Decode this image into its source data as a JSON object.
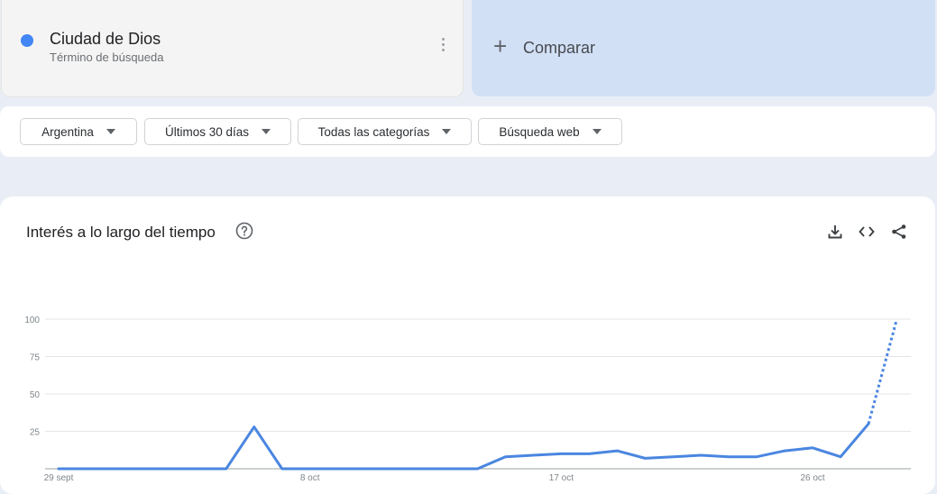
{
  "term": {
    "name": "Ciudad de Dios",
    "subtitle": "Término de búsqueda",
    "color": "#4285f4"
  },
  "compare": {
    "label": "Comparar"
  },
  "filters": [
    {
      "label": "Argentina"
    },
    {
      "label": "Últimos 30 días"
    },
    {
      "label": "Todas las categorías"
    },
    {
      "label": "Búsqueda web"
    }
  ],
  "chart": {
    "title": "Interés a lo largo del tiempo",
    "icons": [
      "download-icon",
      "embed-icon",
      "share-icon"
    ]
  },
  "chart_data": {
    "type": "line",
    "title": "",
    "xlabel": "",
    "ylabel": "",
    "ylim": [
      0,
      100
    ],
    "y_ticks": [
      25,
      50,
      75,
      100
    ],
    "grid": true,
    "x_tick_labels": [
      {
        "label": "29 sept",
        "index": 0
      },
      {
        "label": "8 oct",
        "index": 9
      },
      {
        "label": "17 oct",
        "index": 18
      },
      {
        "label": "26 oct",
        "index": 27
      }
    ],
    "x": [
      "29 sept",
      "30 sept",
      "1 oct",
      "2 oct",
      "3 oct",
      "4 oct",
      "5 oct",
      "6 oct",
      "7 oct",
      "8 oct",
      "9 oct",
      "10 oct",
      "11 oct",
      "12 oct",
      "13 oct",
      "14 oct",
      "15 oct",
      "16 oct",
      "17 oct",
      "18 oct",
      "19 oct",
      "20 oct",
      "21 oct",
      "22 oct",
      "23 oct",
      "24 oct",
      "25 oct",
      "26 oct",
      "27 oct",
      "28 oct",
      "29 oct"
    ],
    "series": [
      {
        "color": "#4a86e0",
        "values": [
          0,
          0,
          0,
          0,
          0,
          0,
          0,
          28,
          0,
          0,
          0,
          0,
          0,
          0,
          0,
          0,
          8,
          9,
          10,
          10,
          12,
          7,
          8,
          9,
          8,
          8,
          12,
          14,
          8,
          30,
          99
        ],
        "partial_from_index": 29
      }
    ]
  }
}
